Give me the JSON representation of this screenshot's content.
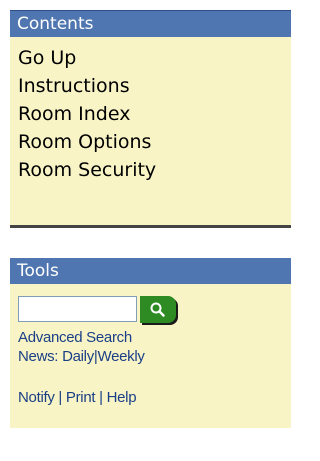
{
  "contents": {
    "header": "Contents",
    "items": [
      {
        "label": "Go Up"
      },
      {
        "label": "Instructions"
      },
      {
        "label": "Room Index"
      },
      {
        "label": "Room Options"
      },
      {
        "label": "Room Security"
      }
    ]
  },
  "tools": {
    "header": "Tools",
    "search": {
      "value": "",
      "placeholder": "",
      "button_icon": "search-icon"
    },
    "advanced_search": "Advanced Search",
    "news": {
      "prefix": "News:",
      "daily": "Daily",
      "separator": "|",
      "weekly": "Weekly"
    },
    "footer": {
      "notify": "Notify",
      "print": "Print",
      "help": "Help",
      "separator": "|"
    }
  },
  "colors": {
    "header_bg": "#4f76b0",
    "panel_bg": "#f8f4c6",
    "link_color": "#1a3f87",
    "search_button_bg": "#2e8a22"
  }
}
